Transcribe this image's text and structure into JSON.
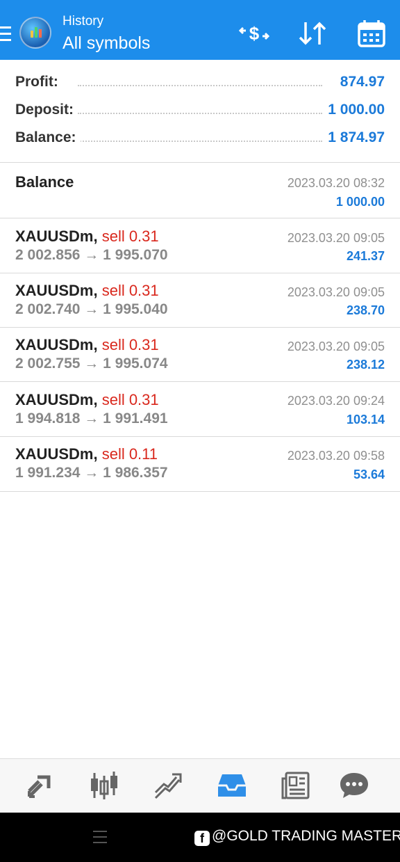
{
  "header": {
    "subtitle": "History",
    "title": "All symbols",
    "icons": [
      "menu-icon",
      "app-logo",
      "currency-exchange-icon",
      "sort-icon",
      "calendar-icon"
    ]
  },
  "summary": {
    "profit_label": "Profit:",
    "profit_value": "874.97",
    "deposit_label": "Deposit:",
    "deposit_value": "1 000.00",
    "balance_label": "Balance:",
    "balance_value": "1 874.97"
  },
  "balance_entry": {
    "label": "Balance",
    "date": "2023.03.20 08:32",
    "amount": "1 000.00"
  },
  "deals": [
    {
      "symbol": "XAUUSDm,",
      "side": "sell 0.31",
      "open": "2 002.856",
      "close": "1 995.070",
      "date": "2023.03.20 09:05",
      "profit": "241.37"
    },
    {
      "symbol": "XAUUSDm,",
      "side": "sell 0.31",
      "open": "2 002.740",
      "close": "1 995.040",
      "date": "2023.03.20 09:05",
      "profit": "238.70"
    },
    {
      "symbol": "XAUUSDm,",
      "side": "sell 0.31",
      "open": "2 002.755",
      "close": "1 995.074",
      "date": "2023.03.20 09:05",
      "profit": "238.12"
    },
    {
      "symbol": "XAUUSDm,",
      "side": "sell 0.31",
      "open": "1 994.818",
      "close": "1 991.491",
      "date": "2023.03.20 09:24",
      "profit": "103.14"
    },
    {
      "symbol": "XAUUSDm,",
      "side": "sell 0.11",
      "open": "1 991.234",
      "close": "1 986.357",
      "date": "2023.03.20 09:58",
      "profit": "53.64"
    }
  ],
  "arrow": "→",
  "bottom_nav": {
    "items": [
      "quotes-icon",
      "chart-icon",
      "trade-icon",
      "history-icon",
      "news-icon",
      "chat-icon"
    ],
    "active": "history-icon",
    "active_color": "#2f8fe8",
    "inactive_color": "#666666"
  },
  "watermark": {
    "fb": "f",
    "text": "@GOLD TRADING  MASTER"
  },
  "colors": {
    "header_bg": "#1d8deb",
    "profit_blue": "#1b7ad9",
    "sell_red": "#d9281d"
  }
}
